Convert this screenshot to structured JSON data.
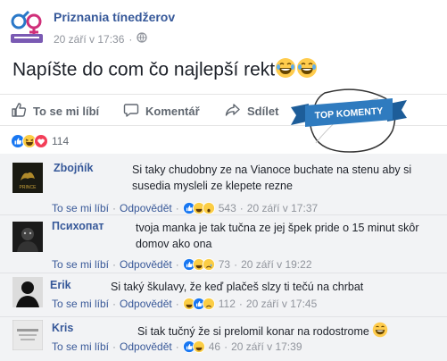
{
  "page": {
    "name": "Priznania tínedžerov",
    "date": "20 září v 17:36",
    "privacy_icon": "globe-icon",
    "post_text": "Napíšte do com čo najlepší rekt",
    "post_emojis": [
      "laughing-face",
      "laughing-face"
    ]
  },
  "actions": {
    "like": "To se mi líbí",
    "comment": "Komentář",
    "share": "Sdílet"
  },
  "banner": {
    "text": "TOP KOMENTY",
    "color": "#2f7bbf"
  },
  "reactions": {
    "count": "114",
    "icons": [
      "like",
      "haha",
      "love"
    ]
  },
  "comment_ui": {
    "like": "To se mi líbí",
    "reply": "Odpovědět"
  },
  "comments": [
    {
      "name": "Zbojńík",
      "text": "Si taky chudobny ze na Vianoce buchate na stenu aby si susedia mysleli ze klepete rezne",
      "reactions": "543",
      "time": "20 září v 17:37"
    },
    {
      "name": "Психопат",
      "text": "tvoja manka je tak tučna ze jej špek pride o 15 minut skôr domov ako ona",
      "reactions": "73",
      "time": "20 září v 19:22"
    },
    {
      "name": "Erik",
      "text": "Si taký škulavy, že keď plačeš slzy ti tečú na chrbat",
      "reactions": "112",
      "time": "20 září v 17:45"
    },
    {
      "name": "Kris",
      "text": "Si tak tučný že si prelomil konar na rodostrome",
      "reactions": "46",
      "time": "20 září v 17:39"
    }
  ]
}
